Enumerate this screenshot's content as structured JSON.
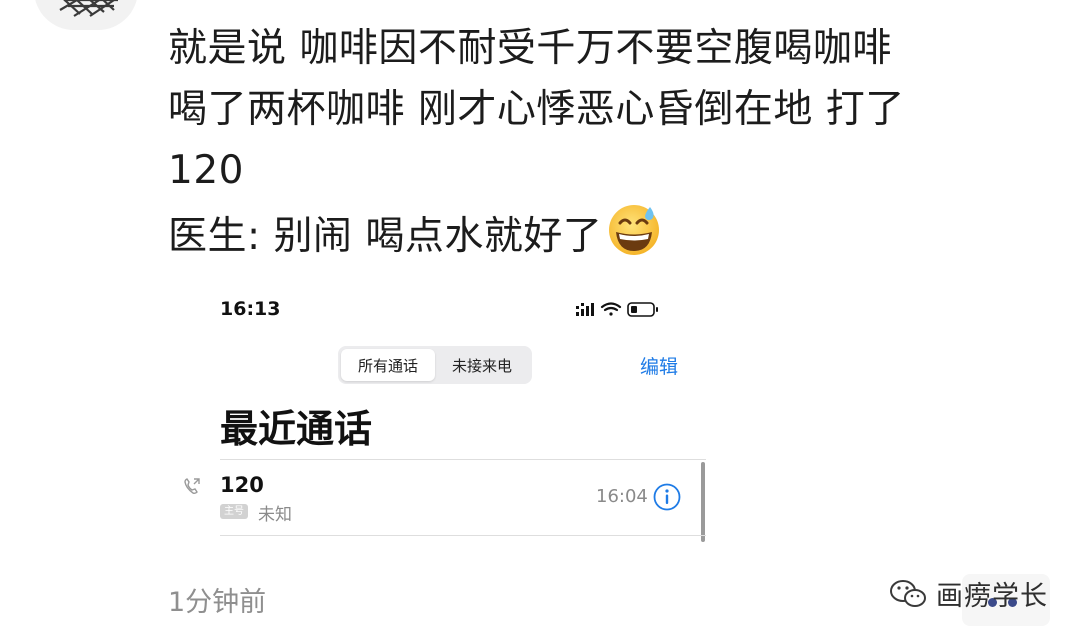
{
  "post": {
    "lines": [
      "就是说 咖啡因不耐受千万不要空腹喝咖啡",
      "喝了两杯咖啡 刚才心悸恶心昏倒在地 打了",
      "120",
      "医生: 别闹 喝点水就好了"
    ],
    "emoji": "grinning-sweat-emoji"
  },
  "screenshot": {
    "status_time": "16:13",
    "segments": [
      "所有通话",
      "未接来电"
    ],
    "active_segment": 0,
    "edit_label": "编辑",
    "title": "最近通话",
    "call": {
      "number": "120",
      "sim_badge": "主号",
      "label": "未知",
      "time": "16:04"
    }
  },
  "footer": {
    "timestamp": "1分钟前",
    "watermark": "画痨学长"
  },
  "colors": {
    "accent": "#1e7be6",
    "secondary_text": "#8a8a8a",
    "timestamp_text": "#8f8f8f"
  }
}
